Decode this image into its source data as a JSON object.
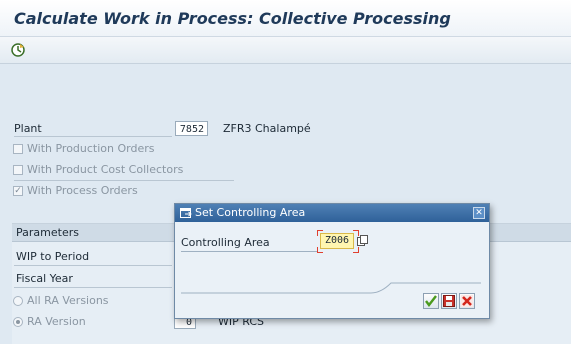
{
  "window": {
    "title": "Calculate Work in Process: Collective Processing"
  },
  "toolbar": {
    "execute_icon": "execute-clock-icon"
  },
  "selection": {
    "plant_label": "Plant",
    "plant_value": "7852",
    "plant_desc": "ZFR3 Chalampé",
    "options": [
      {
        "label": "With Production Orders",
        "checked": false
      },
      {
        "label": "With Product Cost Collectors",
        "checked": false
      },
      {
        "label": "With Process Orders",
        "checked": true
      }
    ]
  },
  "parameters": {
    "header": "Parameters",
    "wip_to_period_label": "WIP to Period",
    "fiscal_year_label": "Fiscal Year",
    "radio_all_label": "All RA Versions",
    "radio_ra_label": "RA Version",
    "ra_version_value": "0",
    "ra_version_desc": "WIP RCS"
  },
  "dialog": {
    "title": "Set Controlling Area",
    "field_label": "Controlling Area",
    "field_value": "Z006",
    "buttons": [
      "confirm-check-icon",
      "save-icon",
      "cancel-x-icon"
    ]
  },
  "colors": {
    "accent": "#2f6199",
    "field_highlight": "#fff6b0",
    "background": "#dfe9f2"
  }
}
